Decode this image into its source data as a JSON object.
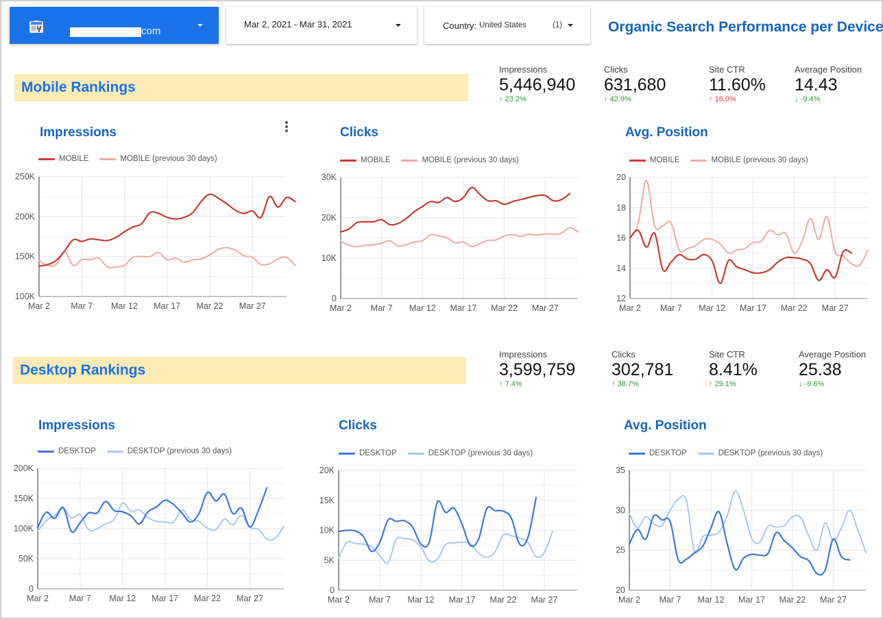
{
  "header": {
    "site_selector": {
      "domain_suffix": "com",
      "icon": "search-console-icon"
    },
    "date_range": "Mar 2, 2021 - Mar 31, 2021",
    "country_filter": {
      "label": "Country:",
      "value": "United States",
      "count": "(1)"
    },
    "title": "Organic Search Performance per Device"
  },
  "sections": [
    {
      "title": "Mobile Rankings",
      "kpis": [
        {
          "label": "Impressions",
          "value": "5,446,940",
          "change": "23.2%",
          "dir": "up",
          "status": "good"
        },
        {
          "label": "Clicks",
          "value": "631,680",
          "change": "42.9%",
          "dir": "up",
          "status": "good"
        },
        {
          "label": "Site CTR",
          "value": "11.60%",
          "change": "16.0%",
          "dir": "up",
          "status": "bad"
        },
        {
          "label": "Average Position",
          "value": "14.43",
          "change": "-9.4%",
          "dir": "down",
          "status": "good"
        }
      ]
    },
    {
      "title": "Desktop Rankings",
      "kpis": [
        {
          "label": "Impressions",
          "value": "3,599,759",
          "change": "7.4%",
          "dir": "up",
          "status": "good"
        },
        {
          "label": "Clicks",
          "value": "302,781",
          "change": "38.7%",
          "dir": "up",
          "status": "good"
        },
        {
          "label": "Site CTR",
          "value": "8.41%",
          "change": "29.1%",
          "dir": "up",
          "status": "good"
        },
        {
          "label": "Average Position",
          "value": "25.38",
          "change": "-9.6%",
          "dir": "down",
          "status": "good"
        }
      ]
    }
  ],
  "colors": {
    "mobile_current": "#c93a30",
    "mobile_previous": "#f0a9a3",
    "desktop_current": "#3b78d8",
    "desktop_previous": "#a9c8f3",
    "title_blue": "#1565c0",
    "banner": "#fdebb5",
    "positive": "#2e9b3e",
    "negative": "#e53935"
  },
  "chart_data": [
    {
      "id": "mobile-impressions",
      "type": "line",
      "title": "Impressions",
      "xlabel": "",
      "ylabel": "",
      "x_tick_labels": [
        "Mar 2",
        "Mar 7",
        "Mar 12",
        "Mar 17",
        "Mar 22",
        "Mar 27"
      ],
      "y_tick_labels": [
        "100K",
        "150K",
        "200K",
        "250K"
      ],
      "ylim": [
        100000,
        250000
      ],
      "y_ticks": [
        100000,
        150000,
        200000,
        250000
      ],
      "grid": true,
      "legend": "top-left",
      "series": [
        {
          "name": "MOBILE",
          "color_key": "mobile_current",
          "values": [
            138000,
            140000,
            145000,
            157000,
            171000,
            169000,
            172000,
            171000,
            170000,
            174000,
            181000,
            187000,
            191000,
            205000,
            204000,
            199000,
            197000,
            199000,
            205000,
            219000,
            228000,
            223000,
            216000,
            208000,
            204000,
            207000,
            199000,
            225000,
            212000,
            224000,
            219000
          ]
        },
        {
          "name": "MOBILE (previous 30 days)",
          "color_key": "mobile_previous",
          "values": [
            145000,
            139000,
            140000,
            156000,
            139000,
            146000,
            146000,
            148000,
            137000,
            137000,
            139000,
            149000,
            150000,
            150000,
            155000,
            146000,
            148000,
            143000,
            146000,
            147000,
            152000,
            159000,
            161000,
            158000,
            151000,
            149000,
            140000,
            141000,
            147000,
            149000,
            139000
          ]
        }
      ]
    },
    {
      "id": "mobile-clicks",
      "type": "line",
      "title": "Clicks",
      "x_tick_labels": [
        "Mar 2",
        "Mar 7",
        "Mar 12",
        "Mar 17",
        "Mar 22",
        "Mar 27"
      ],
      "y_tick_labels": [
        "0",
        "10K",
        "20K",
        "30K"
      ],
      "ylim": [
        0,
        30000
      ],
      "y_ticks": [
        0,
        10000,
        20000,
        30000
      ],
      "grid": true,
      "legend": "top-left",
      "series": [
        {
          "name": "MOBILE",
          "color_key": "mobile_current",
          "values": [
            16500,
            17200,
            18800,
            19000,
            19000,
            19500,
            18300,
            18600,
            19800,
            21500,
            22800,
            24000,
            23800,
            25000,
            24000,
            25000,
            27500,
            25800,
            24200,
            24200,
            23300,
            24000,
            24500,
            25000,
            25500,
            25500,
            24200,
            24500,
            26000
          ]
        },
        {
          "name": "MOBILE (previous 30 days)",
          "color_key": "mobile_previous",
          "values": [
            14200,
            13200,
            12800,
            13200,
            13300,
            13700,
            14300,
            13000,
            13300,
            14000,
            14300,
            15800,
            15500,
            15000,
            13800,
            14000,
            12900,
            13600,
            14400,
            14500,
            15500,
            15800,
            15400,
            15900,
            15700,
            16000,
            15900,
            16200,
            17500,
            16500
          ]
        }
      ]
    },
    {
      "id": "mobile-avg-position",
      "type": "line",
      "title": "Avg. Position",
      "x_tick_labels": [
        "Mar 2",
        "Mar 7",
        "Mar 12",
        "Mar 17",
        "Mar 22",
        "Mar 27"
      ],
      "y_tick_labels": [
        "12",
        "14",
        "16",
        "18",
        "20"
      ],
      "ylim": [
        12,
        20
      ],
      "y_ticks": [
        12,
        14,
        16,
        18,
        20
      ],
      "grid": true,
      "legend": "top-left",
      "series": [
        {
          "name": "MOBILE",
          "color_key": "mobile_current",
          "values": [
            16.0,
            16.5,
            15.4,
            16.3,
            13.9,
            14.4,
            14.9,
            14.6,
            14.6,
            14.9,
            14.5,
            13.0,
            14.5,
            14.1,
            13.9,
            13.7,
            13.7,
            13.9,
            14.4,
            14.7,
            14.7,
            14.6,
            14.3,
            13.2,
            13.9,
            13.4,
            15.1,
            15.0
          ]
        },
        {
          "name": "MOBILE (previous 30 days)",
          "color_key": "mobile_previous",
          "values": [
            16.0,
            17.0,
            19.8,
            16.8,
            16.8,
            17.0,
            15.2,
            15.3,
            15.5,
            15.9,
            15.9,
            15.6,
            15.0,
            15.2,
            15.3,
            15.7,
            15.8,
            16.5,
            16.2,
            16.3,
            15.0,
            15.8,
            17.3,
            15.9,
            17.4,
            15.1,
            14.8,
            14.3,
            14.2,
            15.2
          ]
        }
      ]
    },
    {
      "id": "desktop-impressions",
      "type": "line",
      "title": "Impressions",
      "x_tick_labels": [
        "Mar 2",
        "Mar 7",
        "Mar 12",
        "Mar 17",
        "Mar 22",
        "Mar 27"
      ],
      "y_tick_labels": [
        "0",
        "50K",
        "100K",
        "150K",
        "200K"
      ],
      "ylim": [
        0,
        200000
      ],
      "y_ticks": [
        0,
        50000,
        100000,
        150000,
        200000
      ],
      "grid": true,
      "legend": "top-left",
      "series": [
        {
          "name": "DESKTOP",
          "color_key": "desktop_current",
          "values": [
            102000,
            127000,
            117000,
            135000,
            95000,
            110000,
            126000,
            126000,
            145000,
            130000,
            128000,
            121000,
            108000,
            128000,
            136000,
            147000,
            140000,
            126000,
            111000,
            125000,
            160000,
            146000,
            157000,
            125000,
            134000,
            103000,
            130000,
            168000
          ]
        },
        {
          "name": "DESKTOP (previous 30 days)",
          "color_key": "desktop_previous",
          "values": [
            96000,
            113000,
            122000,
            133000,
            118000,
            123000,
            98000,
            100000,
            108000,
            115000,
            142000,
            129000,
            131000,
            118000,
            112000,
            111000,
            111000,
            131000,
            115000,
            112000,
            101000,
            98000,
            116000,
            106000,
            122000,
            102000,
            99000,
            83000,
            84000,
            104000
          ]
        }
      ]
    },
    {
      "id": "desktop-clicks",
      "type": "line",
      "title": "Clicks",
      "x_tick_labels": [
        "Mar 2",
        "Mar 7",
        "Mar 12",
        "Mar 17",
        "Mar 22",
        "Mar 27"
      ],
      "y_tick_labels": [
        "0",
        "5K",
        "10K",
        "15K",
        "20K"
      ],
      "ylim": [
        0,
        20000
      ],
      "y_ticks": [
        0,
        5000,
        10000,
        15000,
        20000
      ],
      "grid": true,
      "legend": "top-left",
      "series": [
        {
          "name": "DESKTOP",
          "color_key": "desktop_current",
          "values": [
            9800,
            10000,
            9900,
            9000,
            6500,
            8000,
            11700,
            11500,
            11600,
            10500,
            7700,
            8000,
            14700,
            13000,
            13700,
            11000,
            7500,
            8500,
            13600,
            13300,
            13200,
            12000,
            7700,
            8800,
            15500
          ]
        },
        {
          "name": "DESKTOP (previous 30 days)",
          "color_key": "desktop_previous",
          "values": [
            5400,
            8000,
            7800,
            7700,
            7300,
            5800,
            4600,
            8500,
            8600,
            8400,
            7200,
            4900,
            5200,
            7600,
            7900,
            8000,
            7800,
            6200,
            5500,
            6400,
            9200,
            9100,
            8700,
            8000,
            5600,
            6300,
            9800
          ]
        }
      ]
    },
    {
      "id": "desktop-avg-position",
      "type": "line",
      "title": "Avg. Position",
      "x_tick_labels": [
        "Mar 2",
        "Mar 7",
        "Mar 12",
        "Mar 17",
        "Mar 22",
        "Mar 27"
      ],
      "y_tick_labels": [
        "20",
        "25",
        "30",
        "35"
      ],
      "ylim": [
        20,
        35
      ],
      "y_ticks": [
        20,
        25,
        30,
        35
      ],
      "grid": true,
      "legend": "top-left",
      "series": [
        {
          "name": "DESKTOP",
          "color_key": "desktop_current",
          "values": [
            25.8,
            27.6,
            26.4,
            29.3,
            28.8,
            28.6,
            23.8,
            23.9,
            24.7,
            25.5,
            27.8,
            29.8,
            25.8,
            22.6,
            24.0,
            24.5,
            24.4,
            24.6,
            27.2,
            26.2,
            25.3,
            24.2,
            23.7,
            22.1,
            22.5,
            26.4,
            24.2,
            23.8
          ]
        },
        {
          "name": "DESKTOP (previous 30 days)",
          "color_key": "desktop_previous",
          "values": [
            29.6,
            27.8,
            29.2,
            28.3,
            28.1,
            30.0,
            31.4,
            31.2,
            24.8,
            26.7,
            26.9,
            27.3,
            29.3,
            32.4,
            30.0,
            26.5,
            26.0,
            28.0,
            27.9,
            28.1,
            29.2,
            29.1,
            26.8,
            25.0,
            28.4,
            26.2,
            27.8,
            30.0,
            27.6,
            24.7
          ]
        }
      ]
    }
  ]
}
